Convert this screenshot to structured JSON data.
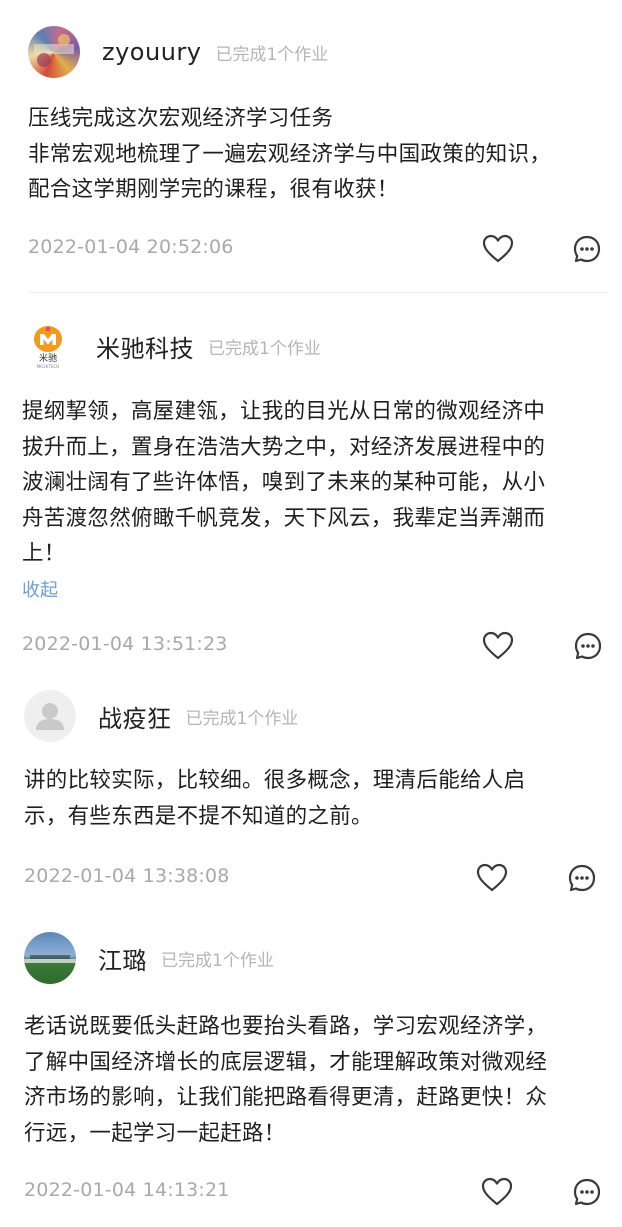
{
  "comments": [
    {
      "username": "zyouury",
      "badge": "已完成1个作业",
      "body": "压线完成这次宏观经济学习任务\n非常宏观地梳理了一遍宏观经济学与中国政策的知识，\n配合这学期刚学完的课程，很有收获！",
      "timestamp": "2022-01-04 20:52:06",
      "avatar": "colorful-photo"
    },
    {
      "username": "米驰科技",
      "badge": "已完成1个作业",
      "body": "提纲挈领，高屋建瓴，让我的目光从日常的微观经济中\n拔升而上，置身在浩浩大势之中，对经济发展进程中的\n波澜壮阔有了些许体悟，嗅到了未来的某种可能，从小\n舟苦渡忽然俯瞰千帆竞发，天下风云，我辈定当弄潮而\n上！",
      "collapse": "收起",
      "timestamp": "2022-01-04 13:51:23",
      "avatar": "brand-logo",
      "logo_text": "米驰",
      "logo_subtext": "MICHITECH"
    },
    {
      "username": "战疫狂",
      "badge": "已完成1个作业",
      "body": "讲的比较实际，比较细。很多概念，理清后能给人启\n示，有些东西是不提不知道的之前。",
      "timestamp": "2022-01-04 13:38:08",
      "avatar": "default-user"
    },
    {
      "username": "江璐",
      "badge": "已完成1个作业",
      "body": "老话说既要低头赶路也要抬头看路，学习宏观经济学，\n了解中国经济增长的底层逻辑，才能理解政策对微观经\n济市场的影响，让我们能把路看得更清，赶路更快！众\n行远，一起学习一起赶路！",
      "timestamp": "2022-01-04 14:13:21",
      "avatar": "landscape-photo"
    }
  ],
  "icons": {
    "like": "heart-icon",
    "reply": "comment-bubble-icon"
  },
  "colors": {
    "username": "#222222",
    "badge": "#b5b5b5",
    "timestamp": "#a9a9a9",
    "link": "#6aa1d6",
    "icon": "#3a3a3a"
  }
}
